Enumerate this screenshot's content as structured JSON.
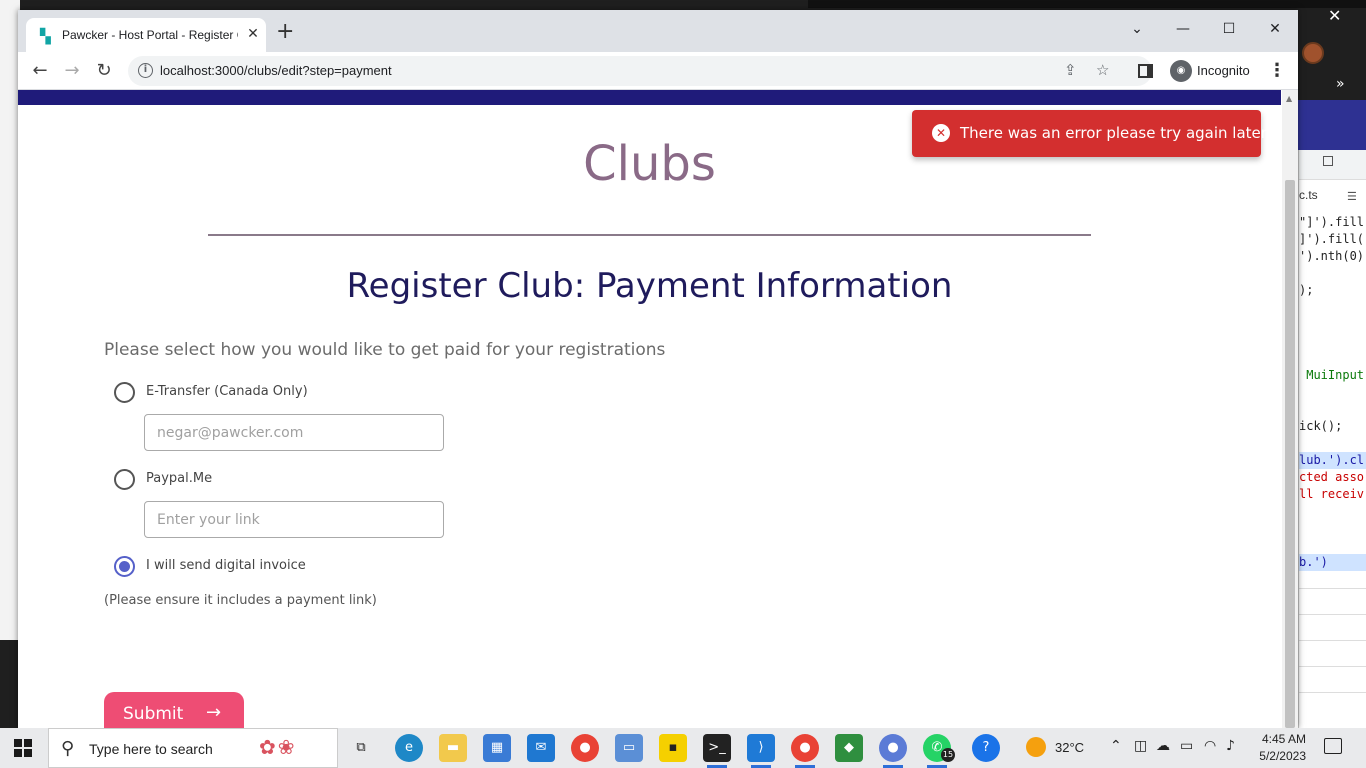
{
  "browser": {
    "tab_title": "Pawcker - Host Portal - Register C",
    "tab_favicon": "dog-icon",
    "url": "localhost:3000/clubs/edit?step=payment",
    "profile_label": "Incognito"
  },
  "page": {
    "title": "Clubs",
    "section_title": "Register Club: Payment Information",
    "prompt": "Please select how you would like to get paid for your registrations",
    "options": [
      {
        "label": "E-Transfer (Canada Only)",
        "selected": false,
        "input_placeholder": "negar@pawcker.com"
      },
      {
        "label": "Paypal.Me",
        "selected": false,
        "input_placeholder": "Enter your link"
      },
      {
        "label": "I will send digital invoice",
        "selected": true
      }
    ],
    "note": "(Please ensure it includes a payment link)",
    "submit_label": "Submit"
  },
  "toast": {
    "message": "There was an error please try again later",
    "color": "#d32f2f"
  },
  "devtools": {
    "file_tab": "c.ts",
    "code_lines": [
      "\"]').fill",
      "]').fill(",
      "').nth(0)",
      "",
      ");",
      "",
      "",
      "",
      "",
      " MuiInput",
      "",
      "",
      "ick();",
      "",
      "lub.').cl",
      "cted asso",
      "ll receiv",
      "",
      "",
      "",
      "b.')"
    ]
  },
  "taskbar": {
    "search_placeholder": "Type here to search",
    "weather": "32°C",
    "time": "4:45 AM",
    "date": "5/2/2023",
    "whatsapp_badge": "15"
  },
  "colors": {
    "accent_pink": "#ee4d74",
    "heading_purple": "#8a6a87",
    "heading_navy": "#1f1b5c",
    "header_bar": "#1f1b7a",
    "radio_selected": "#5560c9"
  }
}
